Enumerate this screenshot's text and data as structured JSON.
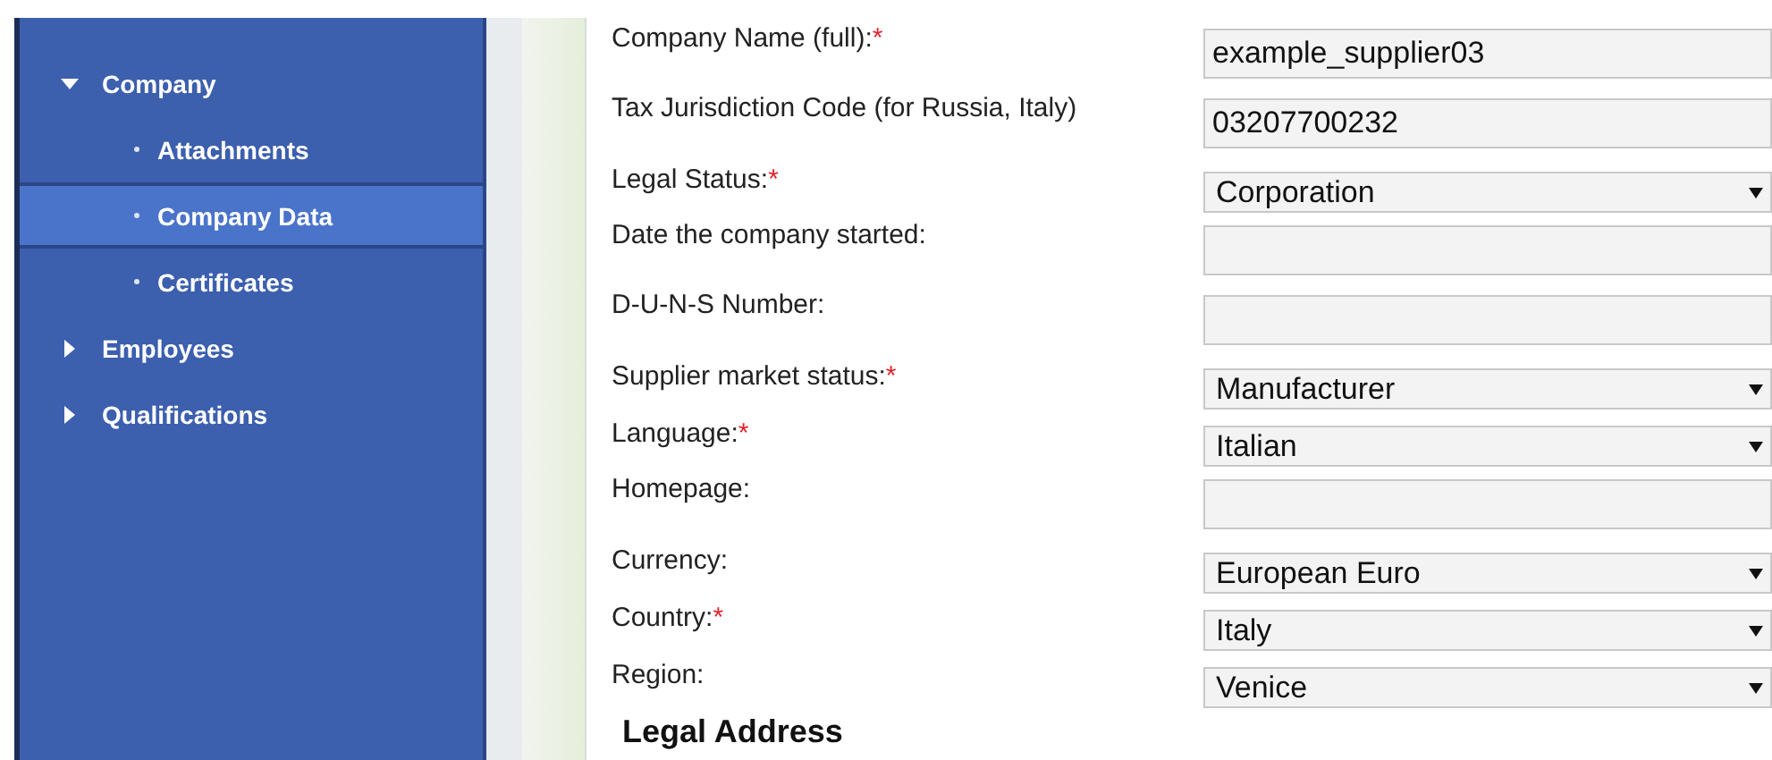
{
  "sidebar": {
    "items": [
      {
        "label": "Company",
        "expanded": true,
        "selected": false,
        "children": [
          {
            "label": "Attachments",
            "selected": false
          },
          {
            "label": "Company Data",
            "selected": true
          },
          {
            "label": "Certificates",
            "selected": false
          }
        ]
      },
      {
        "label": "Employees",
        "expanded": false,
        "selected": false
      },
      {
        "label": "Qualifications",
        "expanded": false,
        "selected": false
      }
    ]
  },
  "form": {
    "fields": [
      {
        "kind": "text",
        "label": "Company Name (full):",
        "required_mark": "*",
        "value": "example_supplier03"
      },
      {
        "kind": "text",
        "label": "Tax Jurisdiction Code (for Russia, Italy)",
        "value": "03207700232"
      },
      {
        "kind": "select",
        "label": "Legal Status:",
        "required_mark": "*",
        "value": "Corporation"
      },
      {
        "kind": "text",
        "label": "Date the company started:"
      },
      {
        "kind": "text",
        "label": "D-U-N-S Number:"
      },
      {
        "kind": "select",
        "label": "Supplier market status:",
        "required_mark": "*",
        "value": "Manufacturer"
      },
      {
        "kind": "select",
        "label": "Language:",
        "required_mark": "*",
        "value": "Italian"
      },
      {
        "kind": "text",
        "label": "Homepage:"
      },
      {
        "kind": "select",
        "label": "Currency:",
        "value": "European Euro"
      },
      {
        "kind": "select",
        "label": "Country:",
        "required_mark": "*",
        "value": "Italy"
      },
      {
        "kind": "select",
        "label": "Region:",
        "value": "Venice"
      }
    ],
    "section_title": "Legal Address"
  }
}
